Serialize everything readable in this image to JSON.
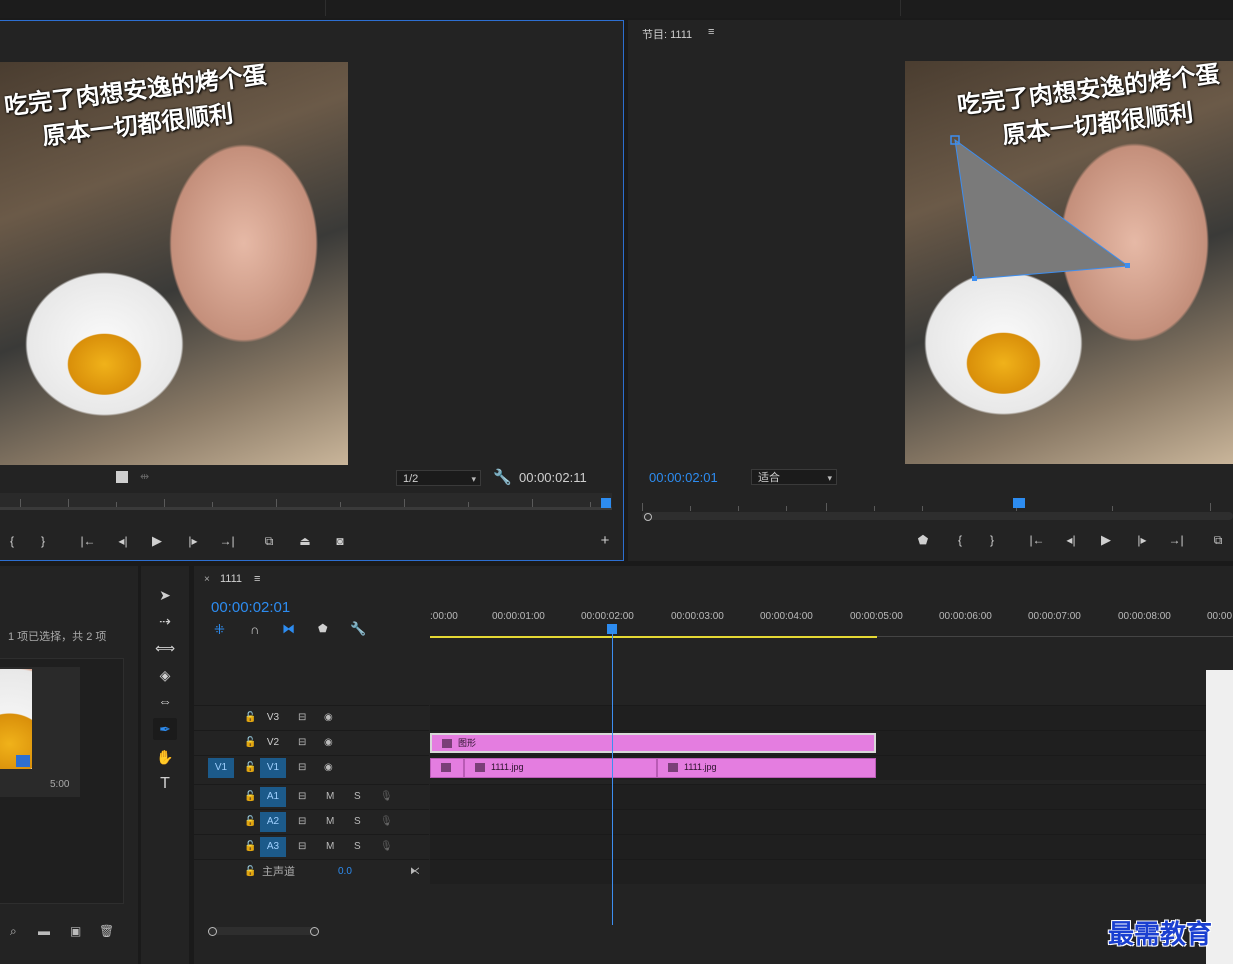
{
  "source_monitor": {
    "caption_line1": "吃完了肉想安逸的烤个蛋",
    "caption_line2": "原本一切都很顺利",
    "resolution": "1/2",
    "timecode": "00:00:02:11"
  },
  "program_monitor": {
    "title": "节目: 1111",
    "menu_icon": "≡",
    "caption_line1": "吃完了肉想安逸的烤个蛋",
    "caption_line2": "原本一切都很顺利",
    "timecode": "00:00:02:01",
    "fit": "适合"
  },
  "project": {
    "selection_status": "1 项已选择，共 2 项",
    "duration": "5:00"
  },
  "timeline": {
    "close": "×",
    "sequence_name": "1111",
    "menu_icon": "≡",
    "timecode": "00:00:02:01",
    "ruler_labels": [
      ":00:00",
      "00:00:01:00",
      "00:00:02:00",
      "00:00:03:00",
      "00:00:04:00",
      "00:00:05:00",
      "00:00:06:00",
      "00:00:07:00",
      "00:00:08:00",
      "00:00"
    ],
    "tracks": {
      "v3": "V3",
      "v2": "V2",
      "v1": "V1",
      "v1_source": "V1",
      "a1": "A1",
      "a2": "A2",
      "a3": "A3",
      "mute": "M",
      "solo": "S",
      "master": "主声道",
      "master_value": "0.0"
    },
    "clips": {
      "graphic": "图形",
      "clip1": "1111.jpg",
      "clip2": "1111.jpg"
    }
  },
  "watermark": {
    "text": "最需教育"
  },
  "colors": {
    "accent": "#2d8cf0",
    "clip": "#e47de0",
    "work_area": "#e5d834"
  }
}
